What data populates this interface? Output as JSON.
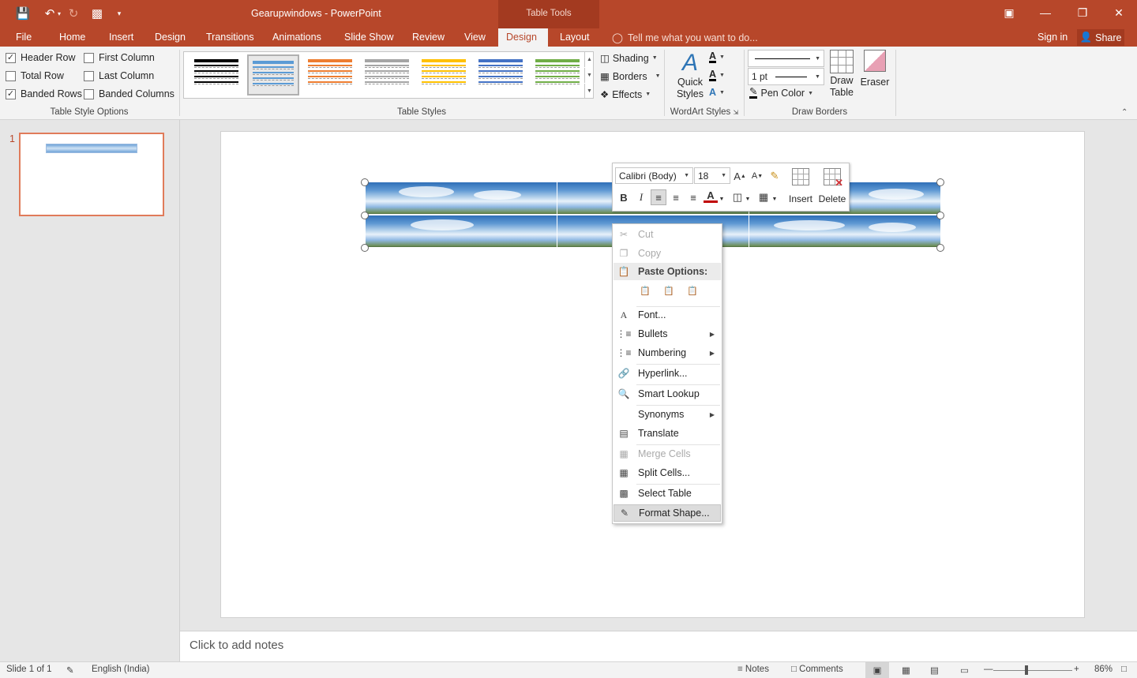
{
  "window": {
    "title": "Gearupwindows - PowerPoint",
    "context_tab_group": "Table Tools"
  },
  "tabs": [
    "File",
    "Home",
    "Insert",
    "Design",
    "Transitions",
    "Animations",
    "Slide Show",
    "Review",
    "View",
    "Design",
    "Layout"
  ],
  "active_tab_index": 9,
  "tell_me": "Tell me what you want to do...",
  "account": {
    "sign_in": "Sign in",
    "share": "Share"
  },
  "ribbon": {
    "table_style_options": {
      "label": "Table Style Options",
      "options": [
        {
          "label": "Header Row",
          "checked": true
        },
        {
          "label": "Total Row",
          "checked": false
        },
        {
          "label": "Banded Rows",
          "checked": true
        },
        {
          "label": "First Column",
          "checked": false
        },
        {
          "label": "Last Column",
          "checked": false
        },
        {
          "label": "Banded Columns",
          "checked": false
        }
      ]
    },
    "table_styles": {
      "label": "Table Styles",
      "swatch_colors": [
        "#000000",
        "#5b9bd5",
        "#ed7d31",
        "#a5a5a5",
        "#ffc000",
        "#4472c4",
        "#70ad47"
      ],
      "selected_index": 1,
      "shading": "Shading",
      "borders": "Borders",
      "effects": "Effects"
    },
    "wordart": {
      "label": "WordArt Styles",
      "quick_styles": "Quick Styles"
    },
    "draw_borders": {
      "label": "Draw Borders",
      "pen_weight": "1 pt",
      "pen_color": "Pen Color",
      "draw_table": "Draw Table",
      "eraser": "Eraser"
    }
  },
  "slides_pane": {
    "slide_number": "1"
  },
  "notes": {
    "placeholder": "Click to add notes"
  },
  "status": {
    "slide": "Slide 1 of 1",
    "language": "English (India)",
    "notes": "Notes",
    "comments": "Comments",
    "zoom": "86%"
  },
  "mini_toolbar": {
    "font": "Calibri (Body)",
    "size": "18",
    "insert": "Insert",
    "delete": "Delete"
  },
  "context_menu": {
    "cut": "Cut",
    "copy": "Copy",
    "paste_options": "Paste Options:",
    "font": "Font...",
    "bullets": "Bullets",
    "numbering": "Numbering",
    "hyperlink": "Hyperlink...",
    "smart_lookup": "Smart Lookup",
    "synonyms": "Synonyms",
    "translate": "Translate",
    "merge_cells": "Merge Cells",
    "split_cells": "Split Cells...",
    "select_table": "Select Table",
    "format_shape": "Format Shape..."
  },
  "colors": {
    "accent": "#b7472a",
    "accent_dark": "#a33a20",
    "font_color_bar": "#c00000"
  }
}
